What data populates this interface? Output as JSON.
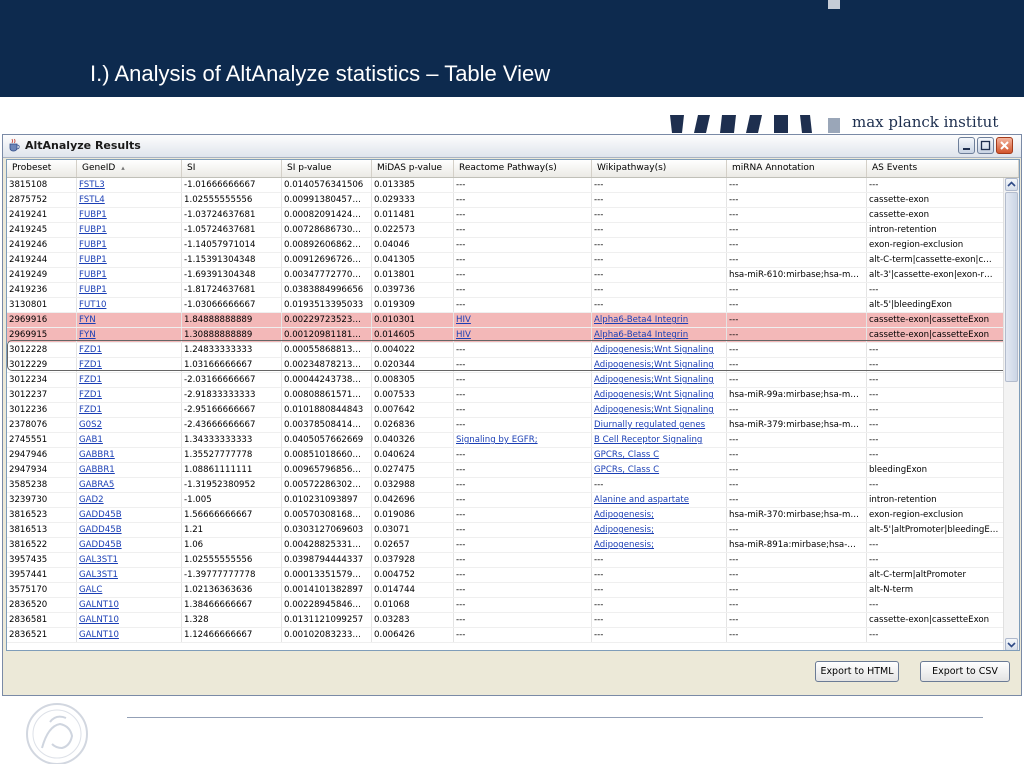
{
  "slide": {
    "title": "I.) Analysis of AltAnalyze statistics – Table View",
    "logo_text": "max planck institut"
  },
  "window": {
    "title": "AltAnalyze Results"
  },
  "table": {
    "columns": [
      "Probeset",
      "GeneID",
      "SI",
      "SI p-value",
      "MiDAS p-value",
      "Reactome Pathway(s)",
      "Wikipathway(s)",
      "miRNA Annotation",
      "AS Events"
    ],
    "sort_indicator": "▴",
    "rows": [
      [
        "3815108",
        "FSTL3",
        "-1.01666666667",
        "0.0140576341506",
        "0.013385",
        "---",
        "---",
        "---",
        "---"
      ],
      [
        "2875752",
        "FSTL4",
        "1.02555555556",
        "0.00991380457…",
        "0.029333",
        "---",
        "---",
        "---",
        "cassette-exon"
      ],
      [
        "2419241",
        "FUBP1",
        "-1.03724637681",
        "0.00082091424…",
        "0.011481",
        "---",
        "---",
        "---",
        "cassette-exon"
      ],
      [
        "2419245",
        "FUBP1",
        "-1.05724637681",
        "0.00728686730…",
        "0.022573",
        "---",
        "---",
        "---",
        "intron-retention"
      ],
      [
        "2419246",
        "FUBP1",
        "-1.14057971014",
        "0.00892606862…",
        "0.04046",
        "---",
        "---",
        "---",
        "exon-region-exclusion"
      ],
      [
        "2419244",
        "FUBP1",
        "-1.15391304348",
        "0.00912696726…",
        "0.041305",
        "---",
        "---",
        "---",
        "alt-C-term|cassette-exon|c…"
      ],
      [
        "2419249",
        "FUBP1",
        "-1.69391304348",
        "0.00347772770…",
        "0.013801",
        "---",
        "---",
        "hsa-miR-610:mirbase;hsa-m…",
        "alt-3'|cassette-exon|exon-r…"
      ],
      [
        "2419236",
        "FUBP1",
        "-1.81724637681",
        "0.0383884996656",
        "0.039736",
        "---",
        "---",
        "---",
        "---"
      ],
      [
        "3130801",
        "FUT10",
        "-1.03066666667",
        "0.0193513395033",
        "0.019309",
        "---",
        "---",
        "---",
        "alt-5'|bleedingExon"
      ],
      [
        "2969916",
        "FYN",
        "1.84888888889",
        "0.00229723523…",
        "0.010301",
        "HIV",
        "Alpha6-Beta4 Integrin",
        "---",
        "cassette-exon|cassetteExon"
      ],
      [
        "2969915",
        "FYN",
        "1.30888888889",
        "0.00120981181…",
        "0.014605",
        "HIV",
        "Alpha6-Beta4 Integrin",
        "---",
        "cassette-exon|cassetteExon"
      ],
      [
        "3012228",
        "FZD1",
        "1.24833333333",
        "0.00055868813…",
        "0.004022",
        "---",
        "Adipogenesis;Wnt Signaling",
        "---",
        "---"
      ],
      [
        "3012229",
        "FZD1",
        "1.03166666667",
        "0.00234878213…",
        "0.020344",
        "---",
        "Adipogenesis;Wnt Signaling",
        "---",
        "---"
      ],
      [
        "3012234",
        "FZD1",
        "-2.03166666667",
        "0.00044243738…",
        "0.008305",
        "---",
        "Adipogenesis;Wnt Signaling",
        "---",
        "---"
      ],
      [
        "3012237",
        "FZD1",
        "-2.91833333333",
        "0.00808861571…",
        "0.007533",
        "---",
        "Adipogenesis;Wnt Signaling",
        "hsa-miR-99a:mirbase;hsa-m…",
        "---"
      ],
      [
        "3012236",
        "FZD1",
        "-2.95166666667",
        "0.0101880844843",
        "0.007642",
        "---",
        "Adipogenesis;Wnt Signaling",
        "---",
        "---"
      ],
      [
        "2378076",
        "G0S2",
        "-2.43666666667",
        "0.00378508414…",
        "0.026836",
        "---",
        "Diurnally regulated genes",
        "hsa-miR-379:mirbase;hsa-m…",
        "---"
      ],
      [
        "2745551",
        "GAB1",
        "1.34333333333",
        "0.0405057662669",
        "0.040326",
        "Signaling by EGFR;",
        "B Cell Receptor Signaling",
        "---",
        "---"
      ],
      [
        "2947946",
        "GABBR1",
        "1.35527777778",
        "0.00851018660…",
        "0.040624",
        "---",
        "GPCRs, Class C",
        "---",
        "---"
      ],
      [
        "2947934",
        "GABBR1",
        "1.08861111111",
        "0.00965796856…",
        "0.027475",
        "---",
        "GPCRs, Class C",
        "---",
        "bleedingExon"
      ],
      [
        "3585238",
        "GABRA5",
        "-1.31952380952",
        "0.00572286302…",
        "0.032988",
        "---",
        "---",
        "---",
        "---"
      ],
      [
        "3239730",
        "GAD2",
        "-1.005",
        "0.010231093897",
        "0.042696",
        "---",
        "Alanine and aspartate",
        "---",
        "intron-retention"
      ],
      [
        "3816523",
        "GADD45B",
        "1.56666666667",
        "0.00570308168…",
        "0.019086",
        "---",
        "Adipogenesis;",
        "hsa-miR-370:mirbase;hsa-m…",
        "exon-region-exclusion"
      ],
      [
        "3816513",
        "GADD45B",
        "1.21",
        "0.0303127069603",
        "0.03071",
        "---",
        "Adipogenesis;",
        "---",
        "alt-5'|altPromoter|bleedingE…"
      ],
      [
        "3816522",
        "GADD45B",
        "1.06",
        "0.00428825331…",
        "0.02657",
        "---",
        "Adipogenesis;",
        "hsa-miR-891a:mirbase;hsa-…",
        "---"
      ],
      [
        "3957435",
        "GAL3ST1",
        "1.02555555556",
        "0.0398794444337",
        "0.037928",
        "---",
        "---",
        "---",
        "---"
      ],
      [
        "3957441",
        "GAL3ST1",
        "-1.39777777778",
        "0.00013351579…",
        "0.004752",
        "---",
        "---",
        "---",
        "alt-C-term|altPromoter"
      ],
      [
        "3575170",
        "GALC",
        "1.02136363636",
        "0.0014101382897",
        "0.014744",
        "---",
        "---",
        "---",
        "alt-N-term"
      ],
      [
        "2836520",
        "GALNT10",
        "1.38466666667",
        "0.00228945846…",
        "0.01068",
        "---",
        "---",
        "---",
        "---"
      ],
      [
        "2836581",
        "GALNT10",
        "1.328",
        "0.0131121099257",
        "0.03283",
        "---",
        "---",
        "---",
        "cassette-exon|cassetteExon"
      ],
      [
        "2836521",
        "GALNT10",
        "1.12466666667",
        "0.00102083233…",
        "0.006426",
        "---",
        "---",
        "---",
        "---"
      ]
    ],
    "highlighted_rows": [
      9,
      10
    ]
  },
  "buttons": {
    "export_html": "Export to HTML",
    "export_csv": "Export to CSV"
  },
  "colors": {
    "header_band": "#0d2a4e",
    "highlight_row": "#f3b8b8",
    "link": "#1b3fb5"
  }
}
